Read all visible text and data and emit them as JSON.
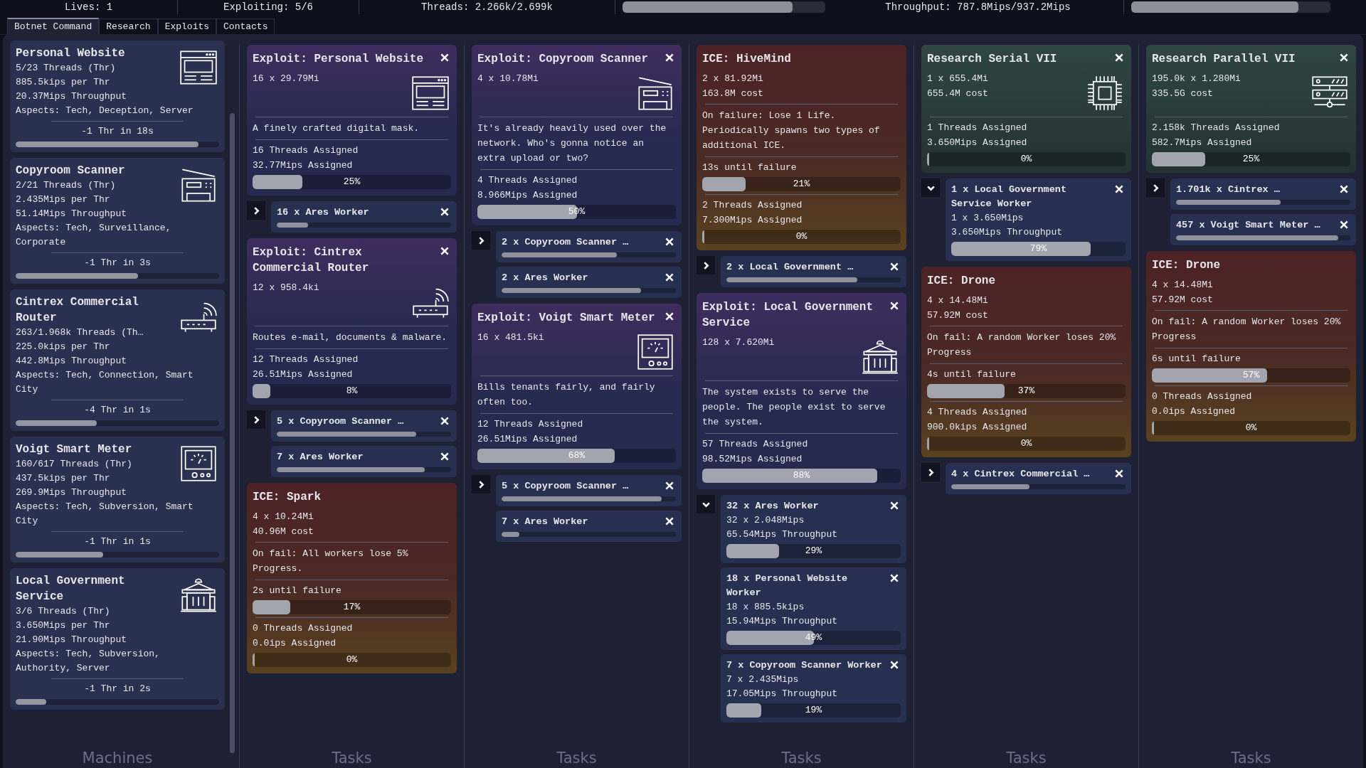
{
  "top_bar": {
    "stats": [
      {
        "text": "Lives: 1"
      },
      {
        "text": "Exploiting: 5/6"
      },
      {
        "text": "Threads: 2.266k/2.699k",
        "level": 0.84
      },
      {
        "text": "Throughput: 787.8Mips/937.2Mips",
        "level": 0.84
      }
    ]
  },
  "tabs": [
    {
      "label": "Botnet Command",
      "selected": true
    },
    {
      "label": "Research",
      "selected": false
    },
    {
      "label": "Exploits",
      "selected": false
    },
    {
      "label": "Contacts",
      "selected": false
    }
  ],
  "machines": {
    "label": "Machines",
    "items": [
      {
        "kind": "website",
        "name": "Personal Website",
        "lines": [
          "5/23 Threads (Thr)",
          "885.5kips per Thr",
          "20.37Mips Throughput",
          "Aspects: Tech, Deception, Server"
        ],
        "countdown": "-1 Thr in 18s",
        "level": 0.9
      },
      {
        "kind": "scanner",
        "name": "Copyroom Scanner",
        "lines": [
          "2/21 Threads (Thr)",
          "2.435Mips per Thr",
          "51.14Mips Throughput",
          "Aspects: Tech, Surveillance, Corporate"
        ],
        "countdown": "-1 Thr in 3s",
        "level": 0.6
      },
      {
        "kind": "router",
        "name": "Cintrex Commercial Router",
        "lines": [
          "263/1.968k Threads (Th…",
          "225.0kips per Thr",
          "442.8Mips Throughput",
          "Aspects: Tech, Connection, Smart City"
        ],
        "countdown": "-4 Thr in 1s",
        "level": 0.4
      },
      {
        "kind": "meter",
        "name": "Voigt Smart Meter",
        "lines": [
          "160/617 Threads (Thr)",
          "437.5kips per Thr",
          "269.9Mips Throughput",
          "Aspects: Tech, Subversion, Smart City"
        ],
        "countdown": "-1 Thr in 1s",
        "level": 0.43
      },
      {
        "kind": "building",
        "name": "Local Government Service",
        "lines": [
          "3/6 Threads (Thr)",
          "3.650Mips per Thr",
          "21.90Mips Throughput",
          "Aspects: Tech, Subversion, Authority, Server"
        ],
        "countdown": "-1 Thr in 2s",
        "level": 0.15
      }
    ]
  },
  "task_columns": [
    {
      "label": "Tasks",
      "tasks": [
        {
          "kind": "exploit",
          "title": "Exploit: Personal Website",
          "stats": [
            "16 x 29.79Mi"
          ],
          "description": "A finely crafted digital mask.",
          "assigned": [
            "16 Threads Assigned",
            "32.77Mips Assigned"
          ],
          "progress": {
            "level": 0.25,
            "reading": "25%"
          },
          "workers": {
            "expanded": false,
            "items": [
              {
                "name": "16 x Ares Worker",
                "level": 0.18
              }
            ]
          }
        },
        {
          "kind": "exploit",
          "title": "Exploit: Cintrex Commercial Router",
          "stats": [
            "12 x 958.4ki"
          ],
          "description": "Routes e-mail, documents & malware.",
          "assigned": [
            "12 Threads Assigned",
            "26.51Mips Assigned"
          ],
          "progress": {
            "level": 0.09,
            "reading": "8%"
          },
          "workers": {
            "expanded": false,
            "items": [
              {
                "name": "5 x Copyroom Scanner …",
                "level": 0.8
              },
              {
                "name": "7 x Ares Worker",
                "level": 0.85
              }
            ]
          }
        },
        {
          "kind": "ice",
          "title": "ICE: Spark",
          "stats": [
            "4 x 10.24Mi",
            "40.96M cost"
          ],
          "description": "On fail: All workers lose 5% Progress.",
          "timer": {
            "label": "2s until failure",
            "level": 0.19,
            "reading": "17%"
          },
          "assigned": [
            "0 Threads Assigned",
            "0.0ips Assigned"
          ],
          "progress": {
            "level": 0,
            "reading": "0%"
          }
        }
      ]
    },
    {
      "label": "Tasks",
      "tasks": [
        {
          "kind": "exploit",
          "title": "Exploit: Copyroom Scanner",
          "stats": [
            "4 x 10.78Mi"
          ],
          "description": "It's already heavily used over the network. Who's gonna notice an extra upload or two?",
          "assigned": [
            "4 Threads Assigned",
            "8.966Mips Assigned"
          ],
          "progress": {
            "level": 0.5,
            "reading": "50%"
          },
          "workers": {
            "expanded": false,
            "items": [
              {
                "name": "2 x Copyroom Scanner …",
                "level": 0.66
              },
              {
                "name": "2 x Ares Worker",
                "level": 0.8
              }
            ]
          }
        },
        {
          "kind": "exploit",
          "title": "Exploit: Voigt Smart Meter",
          "stats": [
            "16 x 481.5ki"
          ],
          "description": "Bills tenants fairly, and fairly often too.",
          "assigned": [
            "12 Threads Assigned",
            "26.51Mips Assigned"
          ],
          "progress": {
            "level": 0.69,
            "reading": "68%"
          },
          "workers": {
            "expanded": false,
            "items": [
              {
                "name": "5 x Copyroom Scanner …",
                "level": 0.92
              },
              {
                "name": "7 x Ares Worker",
                "level": 0.1
              }
            ]
          }
        }
      ]
    },
    {
      "label": "Tasks",
      "tasks": [
        {
          "kind": "ice",
          "title": "ICE: HiveMind",
          "stats": [
            "2 x 81.92Mi",
            "163.8M cost"
          ],
          "description": "On failure: Lose 1 Life. Periodically spawns two types of additional ICE.",
          "timer": {
            "label": "13s until failure",
            "level": 0.22,
            "reading": "21%"
          },
          "assigned": [
            "2 Threads Assigned",
            "7.300Mips Assigned"
          ],
          "progress": {
            "level": 0,
            "reading": "0%"
          },
          "workers": {
            "expanded": false,
            "items": [
              {
                "name": "2 x Local Government …",
                "level": 0.75
              }
            ]
          }
        },
        {
          "kind": "exploit",
          "title": "Exploit: Local Government Service",
          "stats": [
            "128 x 7.620Mi"
          ],
          "description": "The system exists to serve the people. The people exist to serve the system.",
          "assigned": [
            "57 Threads Assigned",
            "98.52Mips Assigned"
          ],
          "progress": {
            "level": 0.88,
            "reading": "88%"
          },
          "workers": {
            "expanded": true,
            "items": [
              {
                "name": "32 x Ares Worker",
                "lines": [
                  "32 x 2.048Mips",
                  "65.54Mips Throughput"
                ],
                "progress": {
                  "level": 0.3,
                  "reading": "29%"
                }
              },
              {
                "name": "18 x Personal Website Worker",
                "lines": [
                  "18 x 885.5kips",
                  "15.94Mips Throughput"
                ],
                "progress": {
                  "level": 0.5,
                  "reading": "49%"
                }
              },
              {
                "name": "7 x Copyroom Scanner Worker",
                "lines": [
                  "7 x 2.435Mips",
                  "17.05Mips Throughput"
                ],
                "progress": {
                  "level": 0.2,
                  "reading": "19%"
                }
              }
            ]
          }
        }
      ]
    },
    {
      "label": "Tasks",
      "tasks": [
        {
          "kind": "research",
          "title": "Research Serial VII",
          "stats": [
            "1 x 655.4Mi",
            "655.4M cost"
          ],
          "assigned": [
            "1 Threads Assigned",
            "3.650Mips Assigned"
          ],
          "progress": {
            "level": 0,
            "reading": "0%"
          },
          "workers": {
            "expanded": true,
            "items": [
              {
                "name": "1 x Local Government Service Worker",
                "lines": [
                  "1 x 3.650Mips",
                  "3.650Mips Throughput"
                ],
                "progress": {
                  "level": 0.8,
                  "reading": "79%"
                }
              }
            ]
          }
        },
        {
          "kind": "ice",
          "title": "ICE: Drone",
          "stats": [
            "4 x 14.48Mi",
            "57.92M cost"
          ],
          "description": "On fail: A random Worker loses 20% Progress",
          "timer": {
            "label": "4s until failure",
            "level": 0.39,
            "reading": "37%"
          },
          "assigned": [
            "4 Threads Assigned",
            "900.0kips Assigned"
          ],
          "progress": {
            "level": 0,
            "reading": "0%"
          },
          "workers": {
            "expanded": false,
            "items": [
              {
                "name": "4 x Cintrex Commercial …",
                "level": 0.45
              }
            ]
          }
        }
      ]
    },
    {
      "label": "Tasks",
      "tasks": [
        {
          "kind": "research",
          "title": "Research Parallel VII",
          "stats": [
            "195.0k x 1.280Mi",
            "335.5G cost"
          ],
          "assigned": [
            "2.158k Threads Assigned",
            "582.7Mips Assigned"
          ],
          "progress": {
            "level": 0.27,
            "reading": "25%"
          },
          "workers": {
            "expanded": false,
            "items": [
              {
                "name": "1.701k x Cintrex …",
                "level": 0.6
              },
              {
                "name": "457 x Voigt Smart Meter …",
                "level": 0.93
              }
            ]
          }
        },
        {
          "kind": "ice",
          "title": "ICE: Drone",
          "stats": [
            "4 x 14.48Mi",
            "57.92M cost"
          ],
          "description": "On fail: A random Worker loses 20% Progress",
          "timer": {
            "label": "6s until failure",
            "level": 0.58,
            "reading": "57%"
          },
          "assigned": [
            "0 Threads Assigned",
            "0.0ips Assigned"
          ],
          "progress": {
            "level": 0,
            "reading": "0%"
          }
        }
      ]
    }
  ]
}
